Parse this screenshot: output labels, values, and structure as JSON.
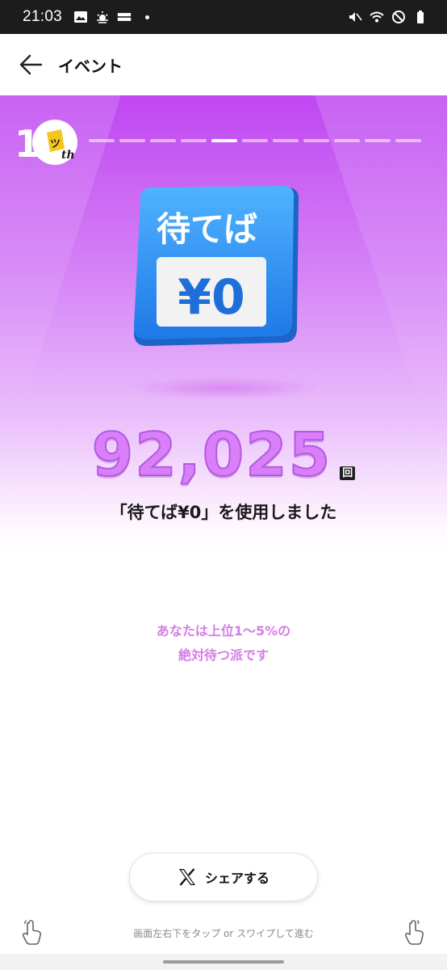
{
  "status_bar": {
    "time": "21:03",
    "left_icons": [
      "gallery-icon",
      "weather-icon",
      "app-notification-icon"
    ],
    "right_icons": [
      "mute-icon",
      "wifi-icon",
      "do-not-disturb-icon",
      "battery-icon"
    ]
  },
  "header": {
    "back_icon": "arrow-left-icon",
    "title": "イベント"
  },
  "hero": {
    "progress": {
      "total": 11,
      "current": 5
    },
    "feature_icon": {
      "line1": "待てば",
      "line2": "¥0"
    },
    "usage_count": "92,025",
    "count_unit": "回",
    "caption": "「待てば¥0」を使用しました"
  },
  "rank": {
    "line1": "あなたは上位1〜5%の",
    "line2": "絶対待つ派です"
  },
  "share": {
    "icon": "x-logo-icon",
    "label": "シェアする"
  },
  "navigation_hint": "画面左右下をタップ or スワイプして進む",
  "colors": {
    "accent_purple": "#c862f3",
    "count_fill": "#d97ff8",
    "rank_text": "#d57ce8",
    "icon_blue": "#2f8ff0"
  }
}
